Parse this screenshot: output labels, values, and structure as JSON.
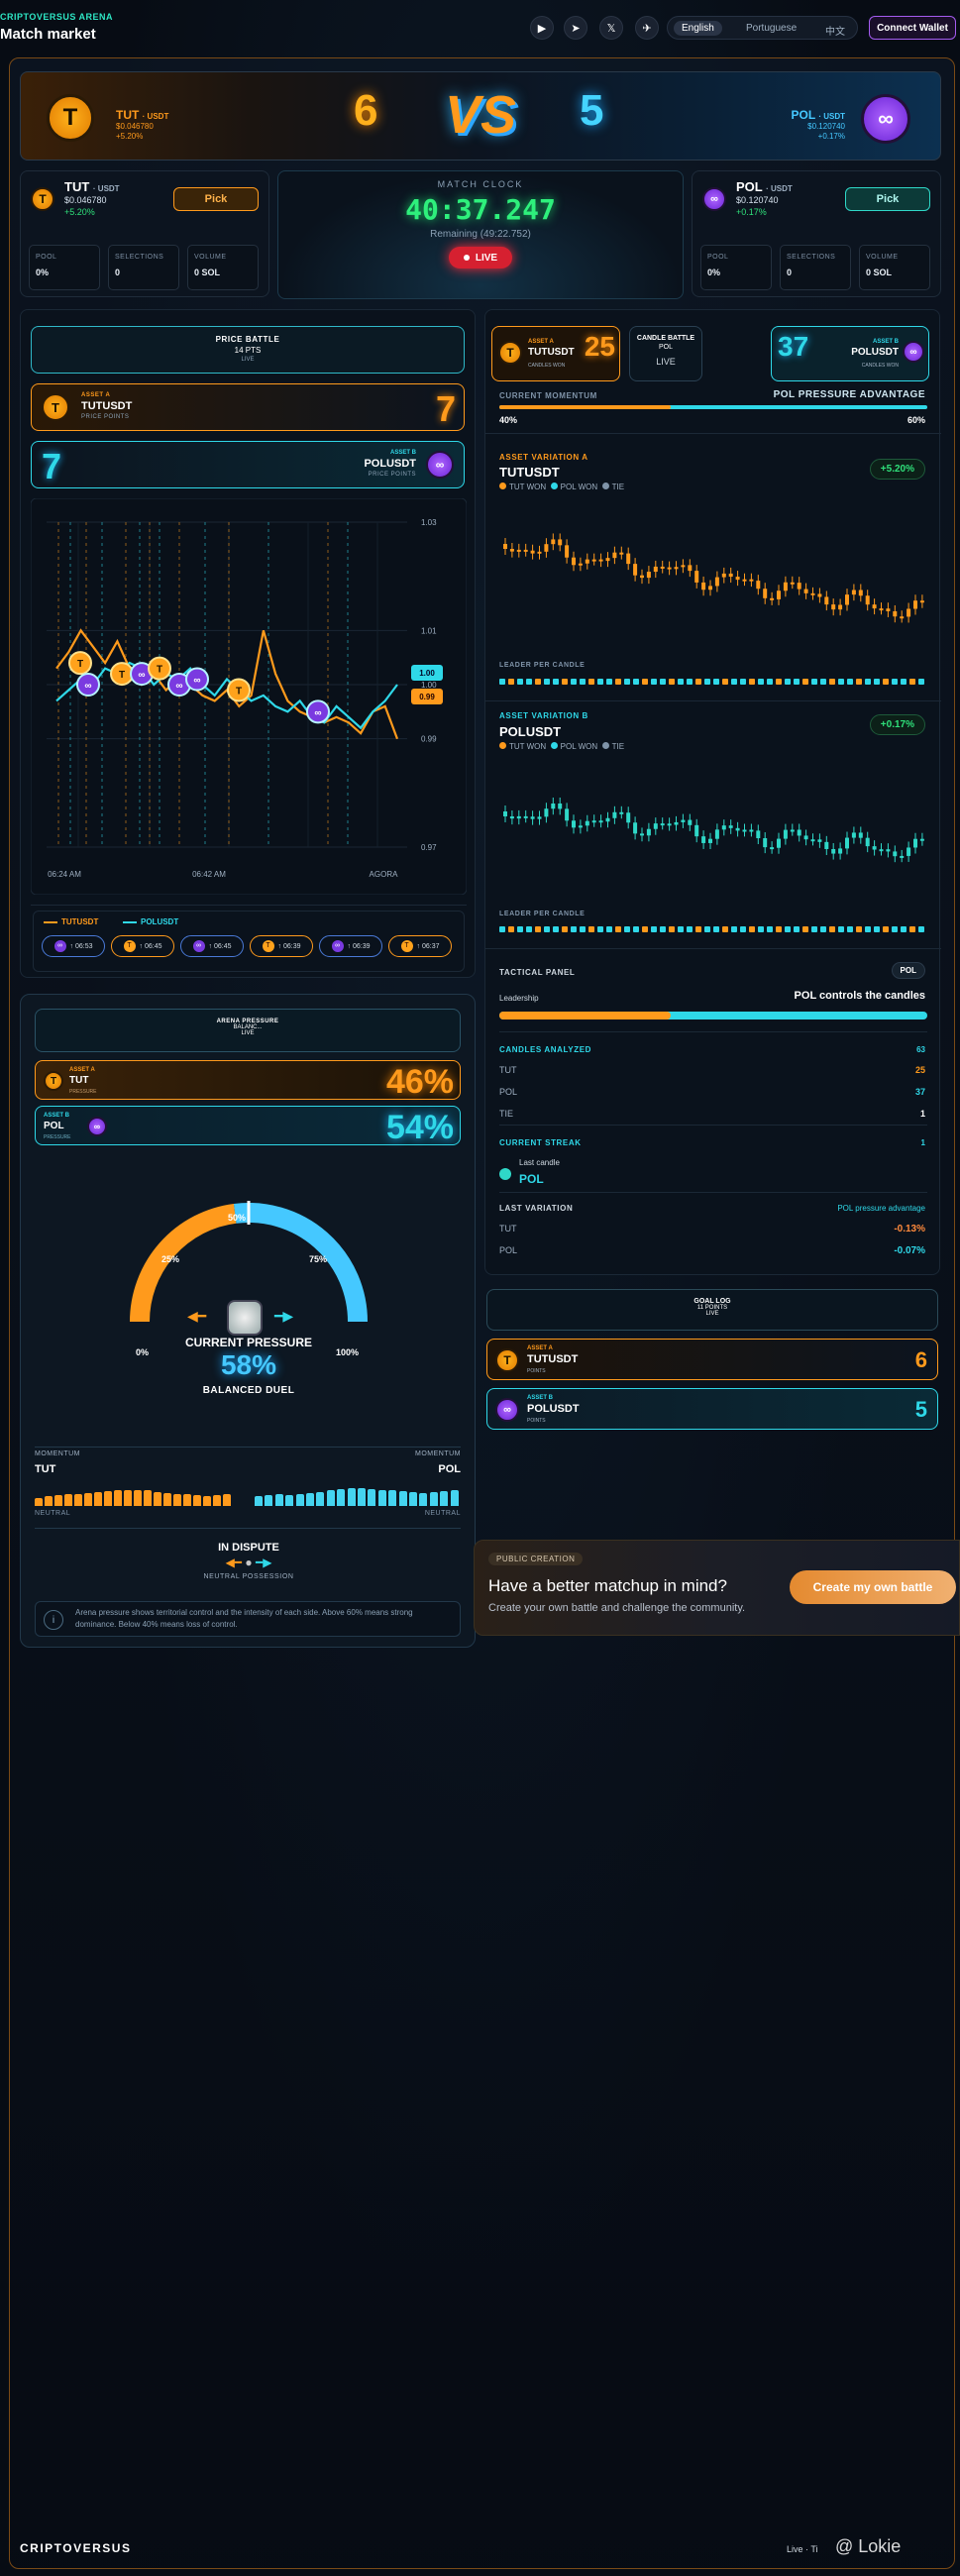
{
  "app": {
    "brand": "CRIPTOVERSUS ARENA",
    "title": "Match market",
    "footer_brand": "CRIPTOVERSUS",
    "footer_live": "Live",
    "footer_right": "Ti",
    "watermark": "@ Lokie"
  },
  "social": {
    "youtube": "▶",
    "telegram_send": "➤",
    "x": "𝕏",
    "telegram": "✈"
  },
  "languages": [
    "English",
    "Portuguese",
    "中文"
  ],
  "language_selected": "English",
  "connect_label": "Connect Wallet",
  "versus": {
    "score_a": "6",
    "score_b": "5",
    "vs": "VS",
    "a": {
      "symbol": "TUT",
      "quote": "· USDT",
      "price": "$0.046780",
      "change": "+5.20%"
    },
    "b": {
      "symbol": "POL",
      "quote": "· USDT",
      "price": "$0.120740",
      "change": "+0.17%"
    }
  },
  "asset_a_card": {
    "symbol": "TUT",
    "quote": "· USDT",
    "price": "$0.046780",
    "change": "+5.20%",
    "pick": "Pick",
    "pool_l": "POOL",
    "pool_v": "0%",
    "sel_l": "SELECTIONS",
    "sel_v": "0",
    "vol_l": "VOLUME",
    "vol_v": "0 SOL"
  },
  "asset_b_card": {
    "symbol": "POL",
    "quote": "· USDT",
    "price": "$0.120740",
    "change": "+0.17%",
    "pick": "Pick",
    "pool_l": "POOL",
    "pool_v": "0%",
    "sel_l": "SELECTIONS",
    "sel_v": "0",
    "vol_l": "VOLUME",
    "vol_v": "0 SOL"
  },
  "clock": {
    "label": "MATCH CLOCK",
    "time": "40:37.247",
    "remaining": "Remaining (49:22.752)",
    "live": "LIVE"
  },
  "price_battle": {
    "title": "PRICE BATTLE",
    "pts": "14 PTS",
    "live": "LIVE",
    "a_tag": "ASSET A",
    "a_name": "TUTUSDT",
    "a_sub": "PRICE POINTS",
    "a_score": "7",
    "b_tag": "ASSET B",
    "b_name": "POLUSDT",
    "b_sub": "PRICE POINTS",
    "b_score": "7"
  },
  "chart_data": {
    "type": "line",
    "series": [
      {
        "name": "TUTUSDT",
        "values": [
          1.003,
          1.006,
          1.01,
          1.007,
          1.004,
          1.008,
          1.003,
          1.0,
          1.002,
          0.999,
          1.001,
          1.0,
          0.998,
          0.997,
          0.999,
          0.996,
          0.998,
          1.01,
          1.002,
          0.997,
          0.995,
          0.994,
          0.993,
          0.994,
          0.993,
          0.991,
          0.995,
          0.996,
          0.99
        ]
      },
      {
        "name": "POLUSDT",
        "values": [
          0.997,
          0.999,
          1.001,
          1.0,
          1.003,
          1.002,
          1.004,
          1.003,
          1.0,
          1.002,
          1.001,
          1.003,
          1.0,
          0.998,
          1.001,
          0.999,
          0.997,
          0.998,
          0.996,
          0.995,
          0.997,
          0.994,
          0.993,
          0.996,
          0.994,
          0.992,
          0.995,
          0.997,
          1.0
        ]
      }
    ],
    "yticks": [
      "1.03",
      "1.01",
      "1.00",
      "0.99",
      "0.97"
    ],
    "ylim": [
      0.97,
      1.03
    ],
    "xticks": [
      "06:24 AM",
      "06:42 AM",
      "AGORA"
    ],
    "last_a": "0.99",
    "last_b": "1.00"
  },
  "goal_chips": [
    {
      "who": "P",
      "time": "06:53"
    },
    {
      "who": "T",
      "time": "06:45"
    },
    {
      "who": "P",
      "time": "06:45"
    },
    {
      "who": "T",
      "time": "06:39"
    },
    {
      "who": "P",
      "time": "06:39"
    },
    {
      "who": "T",
      "time": "06:37"
    }
  ],
  "pressure": {
    "title": "ARENA PRESSURE",
    "sub": "BALANC...",
    "live": "LIVE",
    "a_tag": "ASSET A",
    "a_name": "TUT",
    "a_sub": "PRESSURE",
    "a_pct": "46%",
    "b_tag": "ASSET B",
    "b_name": "POL",
    "b_sub": "PRESSURE",
    "b_pct": "54%",
    "a_value": 0.46,
    "g0": "0%",
    "g25": "25%",
    "g50": "50%",
    "g75": "75%",
    "g100": "100%",
    "current": "CURRENT PRESSURE",
    "value": "58%",
    "duel": "BALANCED DUEL",
    "mom_l": "MOMENTUM",
    "mom_r": "MOMENTUM",
    "mom_a": "TUT",
    "mom_b": "POL",
    "neutral_l": "NEUTRAL",
    "neutral_r": "NEUTRAL",
    "dispute": "IN DISPUTE",
    "possession": "NEUTRAL POSSESSION",
    "note": "Arena pressure shows territorial control and the intensity of each side. Above 60% means strong dominance. Below 40% means loss of control."
  },
  "candle_battle": {
    "a_tag": "ASSET A",
    "a_name": "TUTUSDT",
    "a_sub": "CANDLES WON",
    "a_score": "25",
    "title": "CANDLE BATTLE",
    "sub": "POL",
    "live": "LIVE",
    "b_tag": "ASSET B",
    "b_name": "POLUSDT",
    "b_sub": "CANDLES WON",
    "b_score": "37",
    "momentum": "CURRENT MOMENTUM",
    "adv": "POL PRESSURE ADVANTAGE",
    "a_pct": "40%",
    "b_pct": "60%",
    "a_value": 0.4
  },
  "variation_a": {
    "label": "ASSET VARIATION A",
    "name": "TUTUSDT",
    "leg1": "TUT WON",
    "leg2": "POL WON",
    "leg3": "TIE",
    "badge": "+5.20%",
    "leader": "LEADER PER CANDLE"
  },
  "variation_b": {
    "label": "ASSET VARIATION B",
    "name": "POLUSDT",
    "leg1": "TUT WON",
    "leg2": "POL WON",
    "leg3": "TIE",
    "badge": "+0.17%",
    "leader": "LEADER PER CANDLE"
  },
  "tactical": {
    "title": "TACTICAL PANEL",
    "tag": "POL",
    "leadership": "Leadership",
    "controls": "POL controls the candles",
    "lead_value": 0.4,
    "analyzed": "CANDLES ANALYZED",
    "analyzed_v": "63",
    "tut": "TUT",
    "tut_v": "25",
    "pol": "POL",
    "pol_v": "37",
    "tie": "TIE",
    "tie_v": "1",
    "streak": "CURRENT STREAK",
    "streak_v": "1",
    "last_candle": "Last candle",
    "last_candle_v": "POL",
    "last_var": "LAST VARIATION",
    "last_var_tag": "POL pressure advantage",
    "lv_tut": "TUT",
    "lv_tut_v": "-0.13%",
    "lv_pol": "POL",
    "lv_pol_v": "-0.07%"
  },
  "goal_log": {
    "title": "GOAL LOG",
    "pts": "11 POINTS",
    "live": "LIVE",
    "a_tag": "ASSET A",
    "a_name": "TUTUSDT",
    "a_sub": "POINTS",
    "a_score": "6",
    "b_tag": "ASSET B",
    "b_name": "POLUSDT",
    "b_sub": "POINTS",
    "b_score": "5"
  },
  "creation": {
    "tag": "PUBLIC CREATION",
    "title": "Have a better matchup in mind?",
    "sub": "Create your own battle and challenge the community.",
    "cta": "Create my own battle"
  }
}
